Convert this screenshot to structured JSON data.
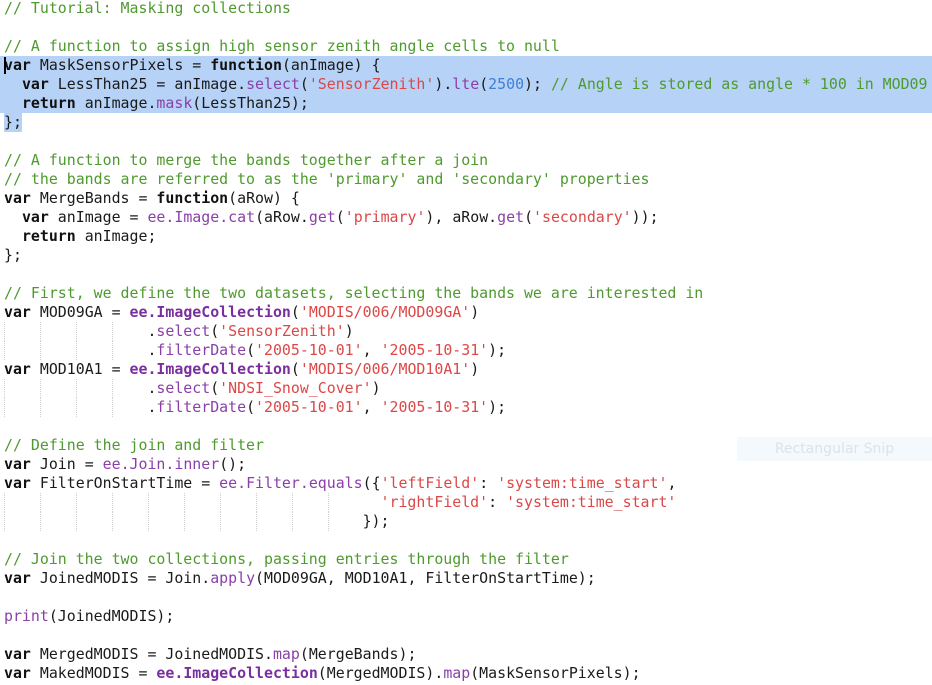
{
  "colors": {
    "comment": "#4e9a2e",
    "string": "#dc4747",
    "function": "#8a3fa8",
    "number": "#3f7fd6",
    "selection": "#b6d2f6"
  },
  "selection": {
    "full_lines": [
      3,
      4,
      5
    ],
    "partial_line": 6,
    "cursor_line": 3
  },
  "guides": {
    "lines": [
      17,
      18,
      20,
      21,
      26,
      27
    ]
  },
  "snip_tooltip": "Rectangular Snip",
  "lines": [
    [
      [
        "c",
        "// Tutorial: Masking collections"
      ]
    ],
    [],
    [
      [
        "c",
        "// A function to assign high sensor zenith angle cells to null"
      ]
    ],
    [
      [
        "k",
        "var"
      ],
      [
        "p",
        " MaskSensorPixels = "
      ],
      [
        "k",
        "function"
      ],
      [
        "p",
        "(anImage) {"
      ]
    ],
    [
      [
        "p",
        "  "
      ],
      [
        "k",
        "var"
      ],
      [
        "p",
        " LessThan25 = anImage."
      ],
      [
        "f",
        "select"
      ],
      [
        "p",
        "("
      ],
      [
        "s",
        "'SensorZenith'"
      ],
      [
        "p",
        ")."
      ],
      [
        "f",
        "lte"
      ],
      [
        "p",
        "("
      ],
      [
        "n",
        "2500"
      ],
      [
        "p",
        "); "
      ],
      [
        "c",
        "// Angle is stored as angle * 100 in MOD09"
      ]
    ],
    [
      [
        "p",
        "  "
      ],
      [
        "k",
        "return"
      ],
      [
        "p",
        " anImage."
      ],
      [
        "f",
        "mask"
      ],
      [
        "p",
        "(LessThan25);"
      ]
    ],
    [
      [
        "p",
        "};"
      ]
    ],
    [],
    [
      [
        "c",
        "// A function to merge the bands together after a join"
      ]
    ],
    [
      [
        "c",
        "// the bands are referred to as the 'primary' and 'secondary' properties"
      ]
    ],
    [
      [
        "k",
        "var"
      ],
      [
        "p",
        " MergeBands = "
      ],
      [
        "k",
        "function"
      ],
      [
        "p",
        "(aRow) {"
      ]
    ],
    [
      [
        "p",
        "  "
      ],
      [
        "k",
        "var"
      ],
      [
        "p",
        " anImage = "
      ],
      [
        "f",
        "ee.Image.cat"
      ],
      [
        "p",
        "(aRow."
      ],
      [
        "f",
        "get"
      ],
      [
        "p",
        "("
      ],
      [
        "s",
        "'primary'"
      ],
      [
        "p",
        "), aRow."
      ],
      [
        "f",
        "get"
      ],
      [
        "p",
        "("
      ],
      [
        "s",
        "'secondary'"
      ],
      [
        "p",
        "));"
      ]
    ],
    [
      [
        "p",
        "  "
      ],
      [
        "k",
        "return"
      ],
      [
        "p",
        " anImage;"
      ]
    ],
    [
      [
        "p",
        "};"
      ]
    ],
    [],
    [
      [
        "c",
        "// First, we define the two datasets, selecting the bands we are interested in"
      ]
    ],
    [
      [
        "k",
        "var"
      ],
      [
        "p",
        " MOD09GA = "
      ],
      [
        "fb",
        "ee.ImageCollection"
      ],
      [
        "p",
        "("
      ],
      [
        "s",
        "'MODIS/006/MOD09GA'"
      ],
      [
        "p",
        ")"
      ]
    ],
    [
      [
        "p",
        "                ."
      ],
      [
        "f",
        "select"
      ],
      [
        "p",
        "("
      ],
      [
        "s",
        "'SensorZenith'"
      ],
      [
        "p",
        ")"
      ]
    ],
    [
      [
        "p",
        "                ."
      ],
      [
        "f",
        "filterDate"
      ],
      [
        "p",
        "("
      ],
      [
        "s",
        "'2005-10-01'"
      ],
      [
        "p",
        ", "
      ],
      [
        "s",
        "'2005-10-31'"
      ],
      [
        "p",
        ");"
      ]
    ],
    [
      [
        "k",
        "var"
      ],
      [
        "p",
        " MOD10A1 = "
      ],
      [
        "fb",
        "ee.ImageCollection"
      ],
      [
        "p",
        "("
      ],
      [
        "s",
        "'MODIS/006/MOD10A1'"
      ],
      [
        "p",
        ")"
      ]
    ],
    [
      [
        "p",
        "                ."
      ],
      [
        "f",
        "select"
      ],
      [
        "p",
        "("
      ],
      [
        "s",
        "'NDSI_Snow_Cover'"
      ],
      [
        "p",
        ")"
      ]
    ],
    [
      [
        "p",
        "                ."
      ],
      [
        "f",
        "filterDate"
      ],
      [
        "p",
        "("
      ],
      [
        "s",
        "'2005-10-01'"
      ],
      [
        "p",
        ", "
      ],
      [
        "s",
        "'2005-10-31'"
      ],
      [
        "p",
        ");"
      ]
    ],
    [],
    [
      [
        "c",
        "// Define the join and filter"
      ]
    ],
    [
      [
        "k",
        "var"
      ],
      [
        "p",
        " Join = "
      ],
      [
        "f",
        "ee.Join.inner"
      ],
      [
        "p",
        "();"
      ]
    ],
    [
      [
        "k",
        "var"
      ],
      [
        "p",
        " FilterOnStartTime = "
      ],
      [
        "f",
        "ee.Filter.equals"
      ],
      [
        "p",
        "({"
      ],
      [
        "s",
        "'leftField'"
      ],
      [
        "p",
        ": "
      ],
      [
        "s",
        "'system:time_start'"
      ],
      [
        "p",
        ","
      ]
    ],
    [
      [
        "p",
        "                                          "
      ],
      [
        "s",
        "'rightField'"
      ],
      [
        "p",
        ": "
      ],
      [
        "s",
        "'system:time_start'"
      ]
    ],
    [
      [
        "p",
        "                                        });"
      ]
    ],
    [],
    [
      [
        "c",
        "// Join the two collections, passing entries through the filter"
      ]
    ],
    [
      [
        "k",
        "var"
      ],
      [
        "p",
        " JoinedMODIS = Join."
      ],
      [
        "f",
        "apply"
      ],
      [
        "p",
        "(MOD09GA, MOD10A1, FilterOnStartTime);"
      ]
    ],
    [],
    [
      [
        "f",
        "print"
      ],
      [
        "p",
        "(JoinedMODIS);"
      ]
    ],
    [],
    [
      [
        "k",
        "var"
      ],
      [
        "p",
        " MergedMODIS = JoinedMODIS."
      ],
      [
        "f",
        "map"
      ],
      [
        "p",
        "(MergeBands);"
      ]
    ],
    [
      [
        "k",
        "var"
      ],
      [
        "p",
        " MakedMODIS = "
      ],
      [
        "fb",
        "ee.ImageCollection"
      ],
      [
        "p",
        "(MergedMODIS)."
      ],
      [
        "f",
        "map"
      ],
      [
        "p",
        "(MaskSensorPixels);"
      ]
    ]
  ]
}
